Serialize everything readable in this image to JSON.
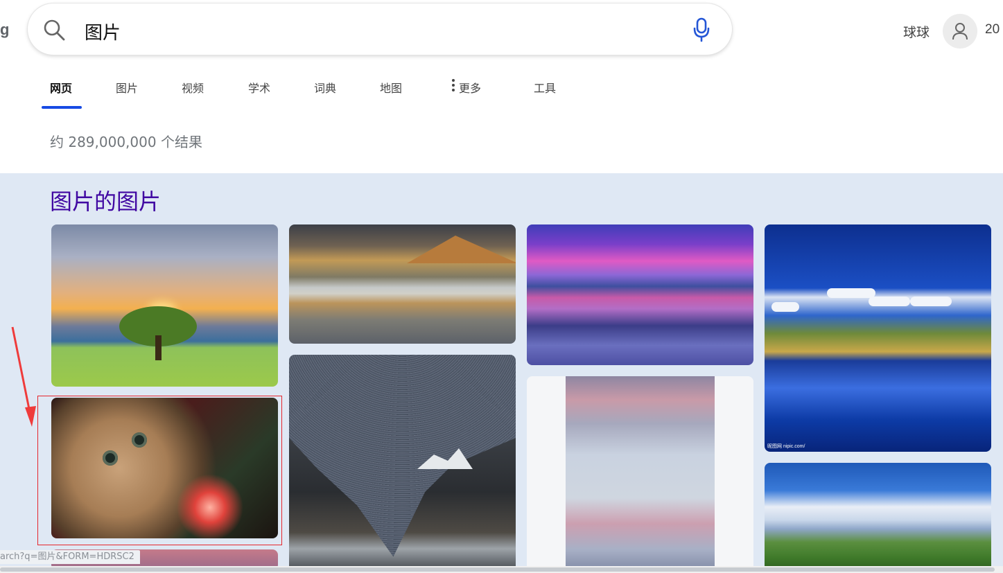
{
  "brand": {
    "fragment": "g"
  },
  "search": {
    "query": "图片"
  },
  "account": {
    "user_name": "球球",
    "points": "20"
  },
  "tabs": [
    {
      "label": "网页",
      "active": true
    },
    {
      "label": "图片"
    },
    {
      "label": "视频"
    },
    {
      "label": "学术"
    },
    {
      "label": "词典"
    },
    {
      "label": "地图"
    },
    {
      "label": "更多"
    },
    {
      "label": "工具"
    }
  ],
  "results": {
    "count_text": "约 289,000,000 个结果"
  },
  "image_panel": {
    "title": "图片的图片",
    "items": [
      {
        "name": "sunset-tree-image"
      },
      {
        "name": "mountain-lake-image"
      },
      {
        "name": "purple-sunset-image"
      },
      {
        "name": "blue-lake-image"
      },
      {
        "name": "cat-image",
        "watermark": ""
      },
      {
        "name": "star-trails-image"
      },
      {
        "name": "clouds-image"
      },
      {
        "name": "green-mountains-image"
      }
    ],
    "blue_lake_watermark": "昵图网 nipic.com/"
  },
  "status_bar": {
    "url": "arch?q=图片&FORM=HDRSC2"
  },
  "colors": {
    "accent": "#174ae4",
    "title": "#4007a2",
    "highlight": "#e5262c",
    "panel_bg": "#dfe8f4"
  }
}
